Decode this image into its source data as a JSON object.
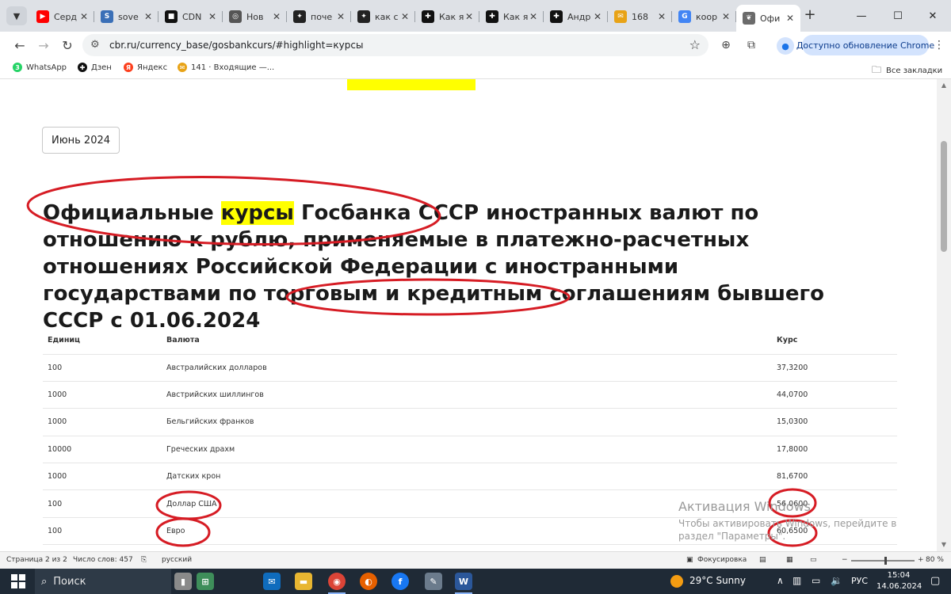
{
  "browser": {
    "tabs": [
      {
        "title": "Серд",
        "favicon_color": "#ff0000",
        "favicon_glyph": "▶"
      },
      {
        "title": "sove",
        "favicon_color": "#3a6fb7",
        "favicon_glyph": "S"
      },
      {
        "title": "CDN",
        "favicon_color": "#111111",
        "favicon_glyph": "■"
      },
      {
        "title": "Нов",
        "favicon_color": "#555555",
        "favicon_glyph": "◎"
      },
      {
        "title": "поче",
        "favicon_color": "#222222",
        "favicon_glyph": "✦"
      },
      {
        "title": "как с",
        "favicon_color": "#222222",
        "favicon_glyph": "✦"
      },
      {
        "title": "Как я",
        "favicon_color": "#111111",
        "favicon_glyph": "✚"
      },
      {
        "title": "Как я",
        "favicon_color": "#111111",
        "favicon_glyph": "✚"
      },
      {
        "title": "Андр",
        "favicon_color": "#111111",
        "favicon_glyph": "✚"
      },
      {
        "title": "168",
        "favicon_color": "#e8a317",
        "favicon_glyph": "✉"
      },
      {
        "title": "коор",
        "favicon_color": "#4285f4",
        "favicon_glyph": "G"
      },
      {
        "title": "Офи",
        "favicon_color": "#6b6b6b",
        "favicon_glyph": "❦",
        "active": true
      }
    ],
    "new_tab": "+",
    "url": "cbr.ru/currency_base/gosbankcurs/#highlight=курсы",
    "update_button": "Доступно обновление Chrome",
    "bookmarks": [
      {
        "label": "WhatsApp",
        "color": "#25d366",
        "glyph": "3"
      },
      {
        "label": "Дзен",
        "color": "#111111",
        "glyph": "✚"
      },
      {
        "label": "Яндекс",
        "color": "#fc3f1d",
        "glyph": "Я"
      },
      {
        "label": "141 · Входящие —...",
        "color": "#e8a317",
        "glyph": "✉"
      }
    ],
    "all_bookmarks": "Все закладки"
  },
  "page": {
    "month_selector": "Июнь 2024",
    "heading": {
      "part1": "Официальные ",
      "highlight": "курсы",
      "part2": " Госбанка СССР иностранных валют по отношению к рублю, применяемые в платежно-расчетных отношениях Российской Федерации с иностранными государствами по торговым и кредитным соглашениям бывшего СССР с 01.06.2024"
    },
    "table": {
      "headers": [
        "Единиц",
        "Валюта",
        "Курс"
      ],
      "rows": [
        [
          "100",
          "Австралийских долларов",
          "37,3200"
        ],
        [
          "1000",
          "Австрийских шиллингов",
          "44,0700"
        ],
        [
          "1000",
          "Бельгийских франков",
          "15,0300"
        ],
        [
          "10000",
          "Греческих драхм",
          "17,8000"
        ],
        [
          "1000",
          "Датских крон",
          "81,6700"
        ],
        [
          "100",
          "Доллар США",
          "56,0600"
        ],
        [
          "100",
          "Евро",
          "60,6500"
        ]
      ]
    },
    "activation_title": "Активация Windows",
    "activation_text": "Чтобы активировать Windows, перейдите в раздел \"Параметры\"."
  },
  "word_status": {
    "page": "Страница 2 из 2",
    "words": "Число слов: 457",
    "language": "русский",
    "focus": "Фокусировка",
    "zoom": "80 %"
  },
  "taskbar": {
    "search": "Поиск",
    "weather": "29°C  Sunny",
    "lang": "РУС",
    "time": "15:04",
    "date": "14.06.2024"
  },
  "colors": {
    "highlight": "#ffff00",
    "annotation": "#d61c24"
  }
}
